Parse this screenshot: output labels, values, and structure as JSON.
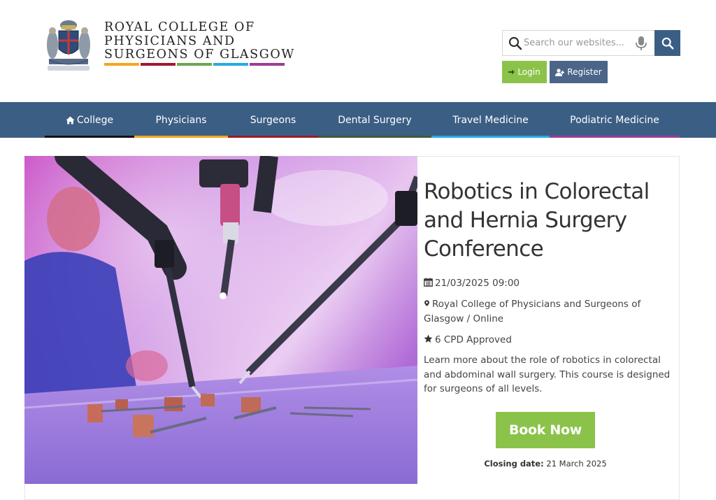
{
  "header": {
    "college_name": "ROYAL COLLEGE OF\nPHYSICIANS AND\nSURGEONS OF GLASGOW",
    "logo_icon": "college-crest",
    "strip_colors": [
      "#f4a623",
      "#9b1b30",
      "#6aa84f",
      "#29a9e1",
      "#9c3d96"
    ],
    "search": {
      "placeholder": "Search our websites..."
    },
    "login_label": "Login",
    "register_label": "Register"
  },
  "nav": {
    "items": [
      {
        "label": "College",
        "icon": "home-icon",
        "color": "#111111"
      },
      {
        "label": "Physicians",
        "color": "#f4a623"
      },
      {
        "label": "Surgeons",
        "color": "#9b1b30"
      },
      {
        "label": "Dental Surgery",
        "color": "#3e5a3a"
      },
      {
        "label": "Travel Medicine",
        "color": "#29a9e1"
      },
      {
        "label": "Podiatric Medicine",
        "color": "#9c3d96"
      }
    ]
  },
  "event": {
    "title": "Robotics in Colorectal and Hernia Surgery Conference",
    "datetime": "21/03/2025 09:00",
    "location": "Royal College of Physicians and Surgeons of Glasgow / Online",
    "cpd": "6 CPD Approved",
    "description": "Learn more about the role of robotics in colorectal and abdominal wall surgery. This course is designed for surgeons of all levels.",
    "book_label": "Book Now",
    "closing_label": "Closing date:",
    "closing_date": "21 March 2025",
    "image": "robotic-surgery-photo"
  },
  "colors": {
    "nav_bg": "#3b5e84",
    "accent_green": "#8bc34a",
    "register_bg": "#4a6587"
  }
}
